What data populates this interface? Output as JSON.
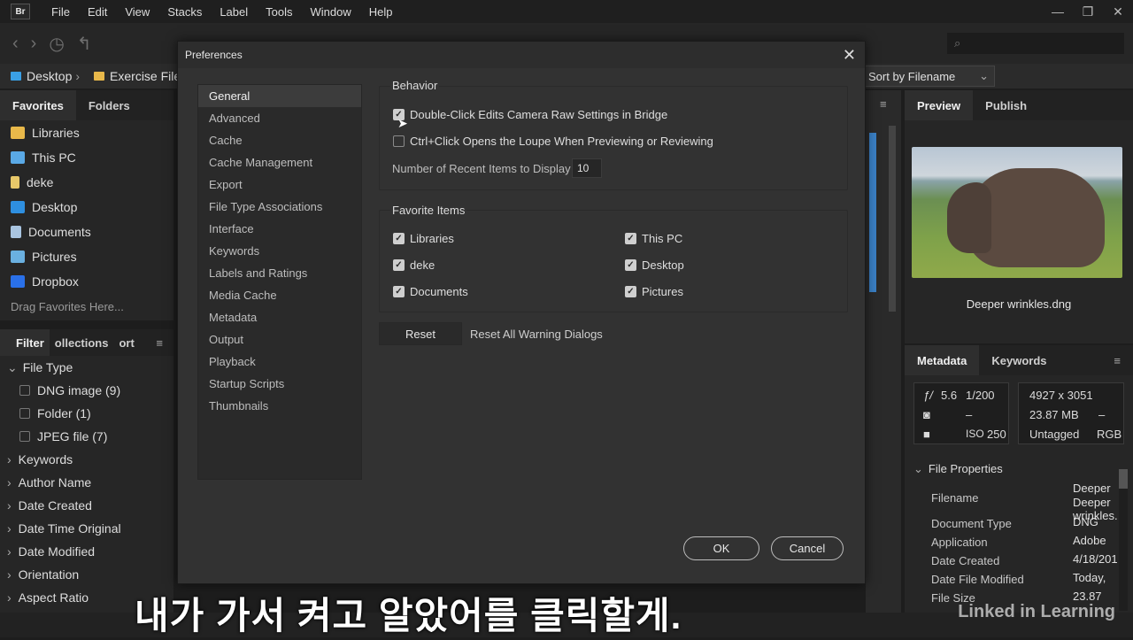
{
  "app": {
    "logo": "Br",
    "menu": [
      "File",
      "Edit",
      "View",
      "Stacks",
      "Label",
      "Tools",
      "Window",
      "Help"
    ]
  },
  "path": {
    "items": [
      "Desktop",
      "Exercise Files"
    ],
    "sort": "Sort by Filename"
  },
  "left": {
    "tabs": [
      "Favorites",
      "Folders"
    ],
    "favorites": [
      "Libraries",
      "This PC",
      "deke",
      "Desktop",
      "Documents",
      "Pictures",
      "Dropbox"
    ],
    "drag_hint": "Drag Favorites Here...",
    "filter_tabs": [
      "Filter",
      "ollections",
      "ort"
    ],
    "file_type": "File Type",
    "file_types": [
      "DNG image (9)",
      "Folder (1)",
      "JPEG file (7)"
    ],
    "criteria": [
      "Keywords",
      "Author Name",
      "Date Created",
      "Date Time Original",
      "Date Modified",
      "Orientation",
      "Aspect Ratio"
    ]
  },
  "dialog": {
    "title": "Preferences",
    "nav": [
      "General",
      "Advanced",
      "Cache",
      "Cache Management",
      "Export",
      "File Type Associations",
      "Interface",
      "Keywords",
      "Labels and Ratings",
      "Media Cache",
      "Metadata",
      "Output",
      "Playback",
      "Startup Scripts",
      "Thumbnails"
    ],
    "behavior_title": "Behavior",
    "opt1": "Double-Click Edits Camera Raw Settings in Bridge",
    "opt2": "Ctrl+Click Opens the Loupe When Previewing or Reviewing",
    "recent_label": "Number of Recent Items to Display",
    "recent_value": "10",
    "fav_title": "Favorite Items",
    "fav_left": [
      "Libraries",
      "deke",
      "Documents"
    ],
    "fav_right": [
      "This PC",
      "Desktop",
      "Pictures"
    ],
    "reset": "Reset",
    "reset_warnings": "Reset All Warning Dialogs",
    "ok": "OK",
    "cancel": "Cancel"
  },
  "right": {
    "tabs": [
      "Preview",
      "Publish"
    ],
    "filename": "Deeper wrinkles.dng",
    "meta_tabs": [
      "Metadata",
      "Keywords"
    ],
    "aperture": "5.6",
    "shutter": "1/200",
    "dash1": "–",
    "iso": "250",
    "dims": "4927 x 3051",
    "size": "23.87 MB",
    "dash2": "–",
    "tag": "Untagged",
    "mode": "RGB",
    "section": "File Properties",
    "props": [
      {
        "k": "Filename",
        "v": "Deeper wrinkles."
      },
      {
        "k": "Document Type",
        "v": "DNG"
      },
      {
        "k": "Application",
        "v": "Adobe"
      },
      {
        "k": "Date Created",
        "v": "4/18/201"
      },
      {
        "k": "Date File Modified",
        "v": "Today,"
      },
      {
        "k": "File Size",
        "v": "23.87"
      }
    ],
    "filename_top": "Deeper"
  },
  "caption": "내가 가서 켜고 알았어를 클릭할게.",
  "watermark": "Linked in Learning"
}
